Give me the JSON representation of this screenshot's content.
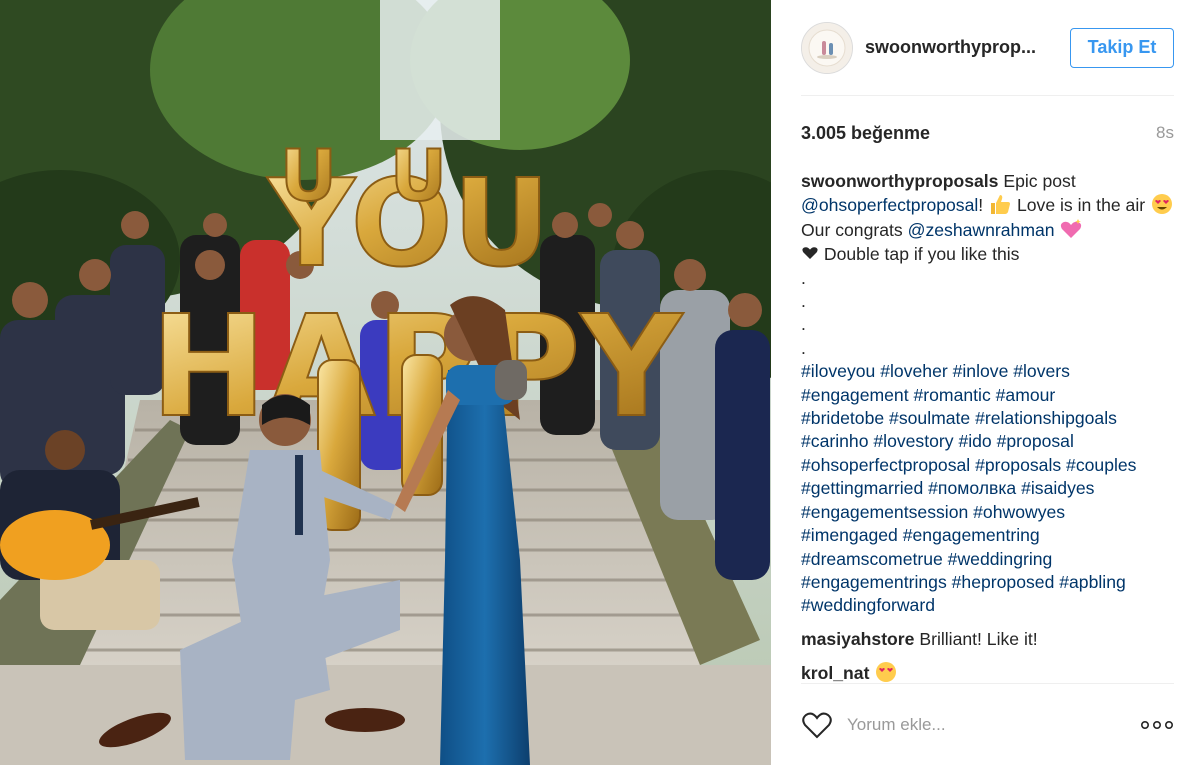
{
  "photo": {
    "balloon_text_top": "YOU",
    "balloon_text_bottom": "HAPPY",
    "balloon_text_small": "U"
  },
  "header": {
    "username": "swoonworthyprop...",
    "follow_label": "Takip Et"
  },
  "stats": {
    "likes": "3.005 beğenme",
    "time": "8s"
  },
  "caption": {
    "user": "swoonworthyproposals",
    "text1": "Epic post",
    "mention1": "@ohsoperfectproposal",
    "text2": "!",
    "text3": "Love is in the air",
    "text4": "Our congrats",
    "mention2": "@zeshawnrahman",
    "text5": "Double tap if you like this",
    "dots": [
      ".",
      ".",
      ".",
      "."
    ],
    "hashtags": [
      "#iloveyou #loveher #inlove #lovers",
      "#engagement #romantic #amour",
      "#bridetobe #soulmate #relationshipgoals",
      "#carinho #lovestory #ido #proposal",
      "#ohsoperfectproposal #proposals #couples",
      "#gettingmarried #помолвка #isaidyes",
      "#engagementsession #ohwowyes",
      "#imengaged #engagementring",
      "#dreamscometrue #weddingring",
      "#engagementrings #heproposed #apbling",
      "#weddingforward"
    ]
  },
  "comments": [
    {
      "user": "masiyahstore",
      "text": "Brilliant! Like it!"
    },
    {
      "user": "krol_nat",
      "text": ""
    }
  ],
  "footer": {
    "placeholder": "Yorum ekle..."
  },
  "colors": {
    "link": "#003569",
    "follow": "#3897f0"
  }
}
